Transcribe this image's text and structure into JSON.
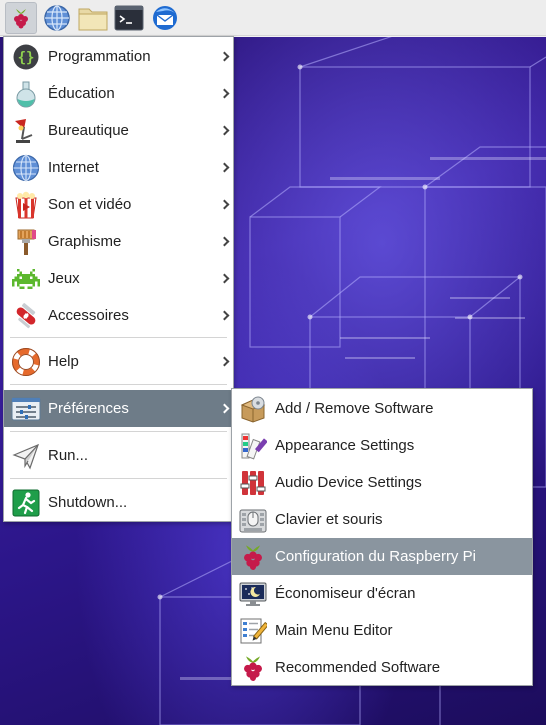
{
  "taskbar": {
    "buttons": [
      {
        "name": "raspberry-menu-button",
        "icon": "raspberry-icon",
        "active": true
      },
      {
        "name": "web-browser-button",
        "icon": "globe-icon"
      },
      {
        "name": "file-manager-button",
        "icon": "folder-icon"
      },
      {
        "name": "terminal-button",
        "icon": "terminal-icon"
      },
      {
        "name": "thunderbird-button",
        "icon": "mail-client-icon"
      }
    ]
  },
  "main_menu": {
    "items": [
      {
        "label": "Programmation",
        "icon": "code-braces-icon",
        "submenu": true
      },
      {
        "label": "Éducation",
        "icon": "flask-icon",
        "submenu": true
      },
      {
        "label": "Bureautique",
        "icon": "desk-lamp-icon",
        "submenu": true
      },
      {
        "label": "Internet",
        "icon": "globe-icon",
        "submenu": true
      },
      {
        "label": "Son et vidéo",
        "icon": "popcorn-icon",
        "submenu": true
      },
      {
        "label": "Graphisme",
        "icon": "paintbrush-icon",
        "submenu": true
      },
      {
        "label": "Jeux",
        "icon": "space-invader-icon",
        "submenu": true
      },
      {
        "label": "Accessoires",
        "icon": "swiss-knife-icon",
        "submenu": true
      },
      {
        "label": "Help",
        "icon": "lifebuoy-icon",
        "submenu": true
      },
      {
        "label": "Préférences",
        "icon": "settings-sliders-icon",
        "submenu": true,
        "highlighted": true
      },
      {
        "label": "Run...",
        "icon": "paper-plane-icon",
        "submenu": false
      },
      {
        "label": "Shutdown...",
        "icon": "exit-running-man-icon",
        "submenu": false
      }
    ]
  },
  "preferences_submenu": {
    "items": [
      {
        "label": "Add / Remove Software",
        "icon": "package-icon"
      },
      {
        "label": "Appearance Settings",
        "icon": "color-palette-icon"
      },
      {
        "label": "Audio Device Settings",
        "icon": "audio-sliders-icon"
      },
      {
        "label": "Clavier et souris",
        "icon": "keyboard-mouse-icon"
      },
      {
        "label": "Configuration du Raspberry Pi",
        "icon": "raspberry-icon",
        "highlighted": true
      },
      {
        "label": "Économiseur d'écran",
        "icon": "screensaver-monitor-icon"
      },
      {
        "label": "Main Menu Editor",
        "icon": "menu-editor-icon"
      },
      {
        "label": "Recommended Software",
        "icon": "raspberry-icon"
      }
    ]
  },
  "colors": {
    "menu_highlight": "#6e7c88",
    "submenu_highlight": "#8a959f",
    "wallpaper": "#2c168a",
    "raspberry_red": "#c51a4a",
    "raspberry_leaf": "#75a928"
  }
}
